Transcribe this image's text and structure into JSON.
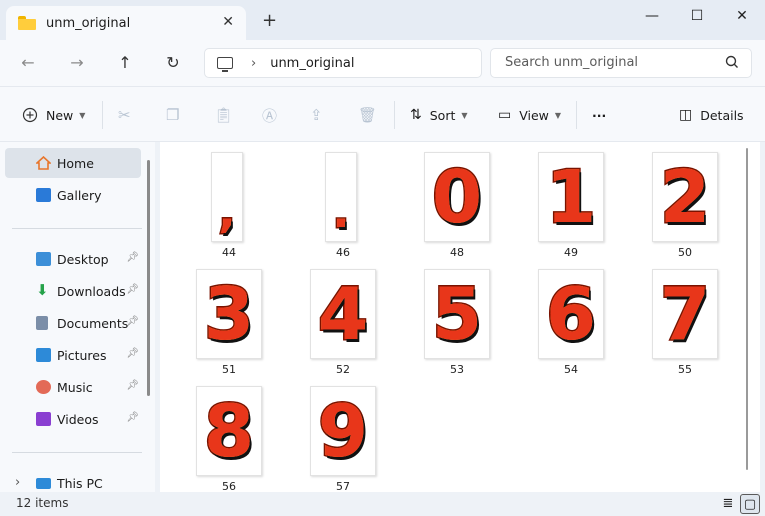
{
  "window": {
    "tab_title": "unm_original",
    "close_tab": "✕",
    "new_tab": "+",
    "minimize": "—",
    "maximize": "☐",
    "close": "✕"
  },
  "nav": {
    "back": "←",
    "forward": "→",
    "up": "↑",
    "refresh": "↻",
    "breadcrumb_separator": "›",
    "breadcrumb": "unm_original",
    "search_placeholder": "Search unm_original"
  },
  "toolbar": {
    "new_label": "New",
    "sort_label": "Sort",
    "view_label": "View",
    "more_label": "···",
    "details_label": "Details",
    "icons": {
      "new": "plus-circle-icon",
      "cut": "scissors-icon",
      "copy": "copy-icon",
      "paste": "clipboard-icon",
      "rename": "rename-icon",
      "share": "share-icon",
      "delete": "trash-icon",
      "sort": "sort-icon",
      "view": "view-icon",
      "details": "details-pane-icon"
    }
  },
  "sidebar": {
    "items": [
      {
        "label": "Home",
        "icon": "home-icon",
        "color": "#e8762c"
      },
      {
        "label": "Gallery",
        "icon": "gallery-icon",
        "color": "#2a7ad8"
      },
      {
        "label": "Desktop",
        "icon": "desktop-icon",
        "color": "#3c8fd8"
      },
      {
        "label": "Downloads",
        "icon": "download-icon",
        "color": "#25a24a"
      },
      {
        "label": "Documents",
        "icon": "documents-icon",
        "color": "#7b8ea8"
      },
      {
        "label": "Pictures",
        "icon": "pictures-icon",
        "color": "#2d8ad8"
      },
      {
        "label": "Music",
        "icon": "music-icon",
        "color": "#e36a57"
      },
      {
        "label": "Videos",
        "icon": "videos-icon",
        "color": "#8a3fd1"
      },
      {
        "label": "This PC",
        "icon": "this-pc-icon",
        "color": "#2d8ad8"
      }
    ],
    "pin_glyph": "📌",
    "expand_glyph": "›"
  },
  "files": [
    {
      "name": "44",
      "glyph": ","
    },
    {
      "name": "46",
      "glyph": "."
    },
    {
      "name": "48",
      "glyph": "0"
    },
    {
      "name": "49",
      "glyph": "1"
    },
    {
      "name": "50",
      "glyph": "2"
    },
    {
      "name": "51",
      "glyph": "3"
    },
    {
      "name": "52",
      "glyph": "4"
    },
    {
      "name": "53",
      "glyph": "5"
    },
    {
      "name": "54",
      "glyph": "6"
    },
    {
      "name": "55",
      "glyph": "7"
    },
    {
      "name": "56",
      "glyph": "8"
    },
    {
      "name": "57",
      "glyph": "9"
    }
  ],
  "status": {
    "item_count": "12 items",
    "details_view": "≣",
    "large_icons_view": "▢"
  },
  "colors": {
    "accent": "#0067c0",
    "glyph_fill": "#e8361a",
    "glyph_outline": "#f6c04a"
  }
}
